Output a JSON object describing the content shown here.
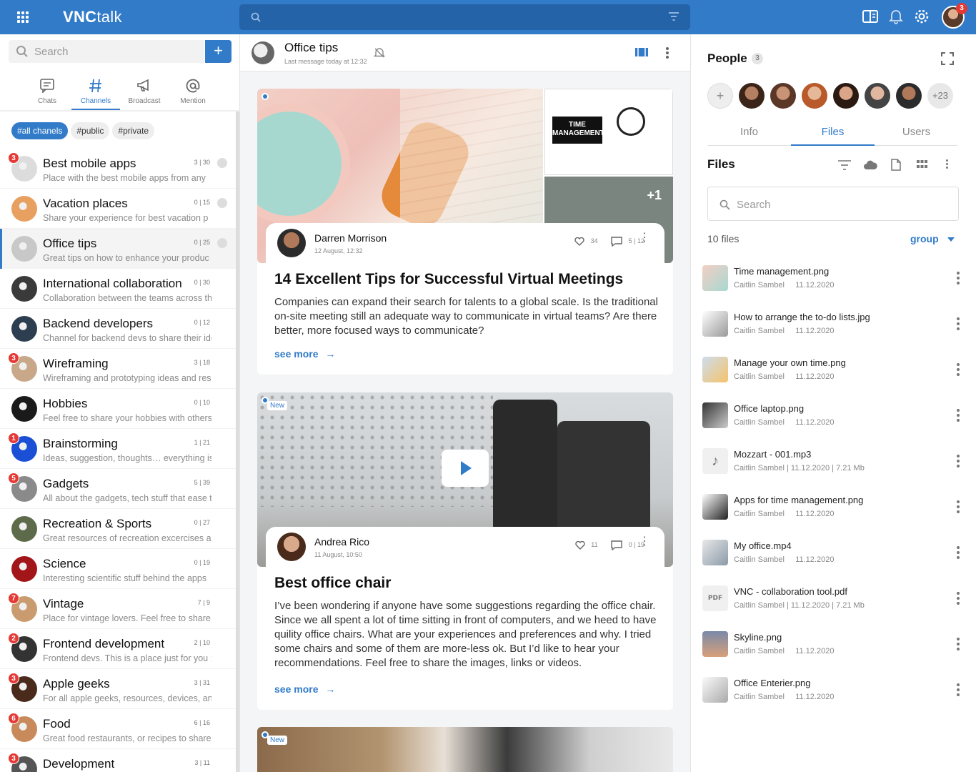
{
  "app": {
    "title_bold": "VNC",
    "title_light": "talk"
  },
  "topbar": {
    "notification_count": "3",
    "accent": "#317bc9"
  },
  "left": {
    "search_placeholder": "Search",
    "add_label": "+",
    "tabs": [
      {
        "label": "Chats",
        "icon": "chat-icon"
      },
      {
        "label": "Channels",
        "icon": "hash-icon"
      },
      {
        "label": "Broadcast",
        "icon": "megaphone-icon"
      },
      {
        "label": "Mention",
        "icon": "at-icon"
      }
    ],
    "chips": [
      "#all chanels",
      "#public",
      "#private"
    ],
    "channels": [
      {
        "name": "Best mobile apps",
        "preview": "Place with the best mobile apps from any",
        "count": "3 | 30",
        "badge": "3"
      },
      {
        "name": "Vacation places",
        "preview": "Share your experience for best vacation p",
        "count": "0 | 15",
        "badge": ""
      },
      {
        "name": "Office tips",
        "preview": "Great tips on how to enhance your produc",
        "count": "0 | 25",
        "badge": ""
      },
      {
        "name": "International collaboration",
        "preview": "Collaboration between the teams across th",
        "count": "0 | 30",
        "badge": ""
      },
      {
        "name": "Backend developers",
        "preview": "Channel for backend devs to share their ide",
        "count": "0 | 12",
        "badge": ""
      },
      {
        "name": "Wireframing",
        "preview": "Wireframing and prototyping ideas and reso",
        "count": "3 | 18",
        "badge": "3"
      },
      {
        "name": "Hobbies",
        "preview": "Feel free to share your hobbies with others",
        "count": "0 | 10",
        "badge": ""
      },
      {
        "name": "Brainstorming",
        "preview": "Ideas, suggestion, thoughts… everything is",
        "count": "1 | 21",
        "badge": "1"
      },
      {
        "name": "Gadgets",
        "preview": "All about the gadgets, tech stuff that ease t",
        "count": "5 | 39",
        "badge": "5"
      },
      {
        "name": "Recreation & Sports",
        "preview": "Great resources of recreation excercises an",
        "count": "0 | 27",
        "badge": ""
      },
      {
        "name": "Science",
        "preview": "Interesting scientific stuff behind the apps",
        "count": "0 | 19",
        "badge": ""
      },
      {
        "name": "Vintage",
        "preview": "Place for vintage lovers. Feel free to share y",
        "count": "7 | 9",
        "badge": "7"
      },
      {
        "name": "Frontend development",
        "preview": "Frontend devs. This is a place just for you :)",
        "count": "2 | 10",
        "badge": "2"
      },
      {
        "name": "Apple geeks",
        "preview": "For all apple geeks, resources, devices, and",
        "count": "3 | 31",
        "badge": "3"
      },
      {
        "name": "Food",
        "preview": "Great food restaurants, or recipes to share",
        "count": "6 | 16",
        "badge": "6"
      },
      {
        "name": "Development",
        "preview": "",
        "count": "3 | 11",
        "badge": "3"
      }
    ]
  },
  "center": {
    "title": "Office tips",
    "subtitle": "Last message today at 12:32",
    "posts": [
      {
        "author": "Darren Morrison",
        "date": "12 August, 12:32",
        "likes": "34",
        "comments": "5 | 12",
        "extra_images": "+1",
        "image_text": "TIME MANAGEMENT",
        "title": "14 Excellent Tips for Successful Virtual Meetings",
        "body": "Companies can expand their search for talents to a global scale. Is the traditional on-site meeting still an adequate way to communicate in virtual teams? Are there better, more focused ways to communicate?",
        "more": "see more"
      },
      {
        "tag": "New",
        "author": "Andrea Rico",
        "date": "11 August, 10:50",
        "likes": "11",
        "comments": "0 | 19",
        "title": "Best office chair",
        "body": "I’ve been wondering if anyone have some suggestions regarding the office chair. Since we all spent a lot of time sitting in front of computers, and we heed to have quility office chairs. What are your experiences and preferences and why. I tried some chairs and some of them are more-less ok. But I’d like to hear your recommendations. Feel free to share the images, links or videos.",
        "more": "see more"
      },
      {
        "tag": "New"
      }
    ]
  },
  "right": {
    "people_label": "People",
    "people_count": "3",
    "more_people": "+23",
    "add_person": "+",
    "tabs": [
      "Info",
      "Files",
      "Users"
    ],
    "files_heading": "Files",
    "search_placeholder": "Search",
    "file_count": "10 files",
    "group_label": "group",
    "files": [
      {
        "name": "Time management.png",
        "meta": "Caitlin Sambel     11.12.2020"
      },
      {
        "name": "How to arrange the to-do lists.jpg",
        "meta": "Caitlin Sambel     11.12.2020"
      },
      {
        "name": "Manage your own time.png",
        "meta": "Caitlin Sambel     11.12.2020"
      },
      {
        "name": "Office laptop.png",
        "meta": "Caitlin Sambel     11.12.2020"
      },
      {
        "name": "Mozzart - 001.mp3",
        "meta": "Caitlin Sambel | 11.12.2020 | 7.21 Mb"
      },
      {
        "name": "Apps for time management.png",
        "meta": "Caitlin Sambel     11.12.2020"
      },
      {
        "name": "My office.mp4",
        "meta": "Caitlin Sambel     11.12.2020"
      },
      {
        "name": "VNC - collaboration tool.pdf",
        "meta": "Caitlin Sambel | 11.12.2020 | 7.21 Mb"
      },
      {
        "name": "Skyline.png",
        "meta": "Caitlin Sambel     11.12.2020"
      },
      {
        "name": "Office Enterier.png",
        "meta": "Caitlin Sambel     11.12.2020"
      }
    ]
  }
}
